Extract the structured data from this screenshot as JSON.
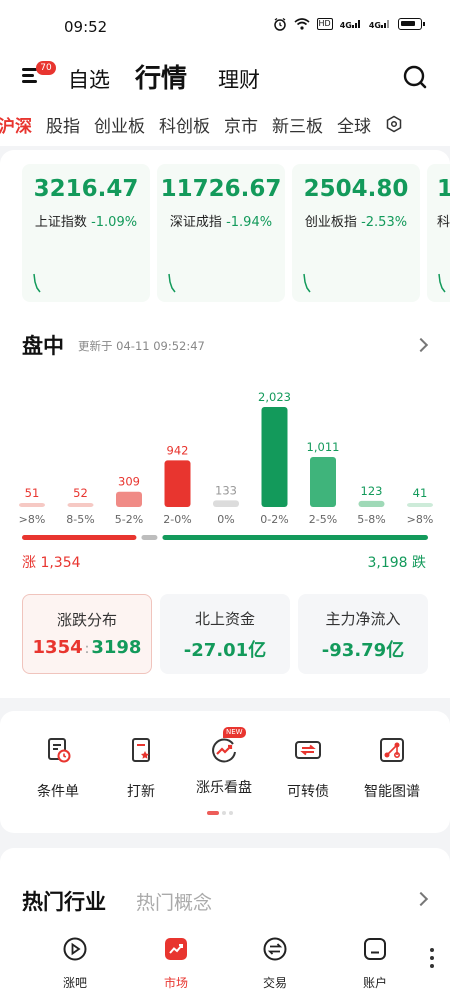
{
  "status_bar": {
    "time": "09:52",
    "hd": "HD",
    "net1": "4G",
    "net2": "4G"
  },
  "header": {
    "badge": "70",
    "tabs": [
      "自选",
      "行情",
      "理财"
    ],
    "active_tab": 1
  },
  "market_tabs": {
    "items": [
      "沪深",
      "股指",
      "创业板",
      "科创板",
      "京市",
      "新三板",
      "全球"
    ],
    "active": 0
  },
  "indices": [
    {
      "value": "3216.47",
      "name": "上证指数",
      "change": "-1.09%"
    },
    {
      "value": "11726.67",
      "name": "深证成指",
      "change": "-1.94%"
    },
    {
      "value": "2504.80",
      "name": "创业板指",
      "change": "-2.53%"
    },
    {
      "value": "1",
      "name": "科",
      "change": ""
    }
  ],
  "intraday": {
    "title": "盘中",
    "update": "更新于 04-11 09:52:47"
  },
  "chart_data": {
    "type": "bar",
    "categories": [
      ">8%",
      "8-5%",
      "5-2%",
      "2-0%",
      "0%",
      "0-2%",
      "2-5%",
      "5-8%",
      ">8%"
    ],
    "values": [
      51,
      52,
      309,
      942,
      133,
      2023,
      1011,
      123,
      41
    ],
    "value_labels": [
      "51",
      "52",
      "309",
      "942",
      "133",
      "2,023",
      "1,011",
      "123",
      "41"
    ],
    "colors": [
      "#f6c9c4",
      "#f6c9c4",
      "#f08b86",
      "#e8352f",
      "#dcdcdc",
      "#139a5b",
      "#3fb47b",
      "#9fd9b7",
      "#cdebd9"
    ],
    "label_colors": [
      "#e8352f",
      "#e8352f",
      "#e8352f",
      "#e8352f",
      "#999999",
      "#139a5b",
      "#139a5b",
      "#139a5b",
      "#139a5b"
    ]
  },
  "breadth": {
    "up_label": "涨 1,354",
    "down_label": "3,198 跌",
    "up": 1354,
    "flat": 133,
    "down": 3198
  },
  "summary_cards": [
    {
      "title": "涨跌分布",
      "up": "1354",
      "sep": ":",
      "down": "3198"
    },
    {
      "title": "北上资金",
      "value": "-27.01亿"
    },
    {
      "title": "主力净流入",
      "value": "-93.79亿"
    }
  ],
  "tools": [
    {
      "label": "条件单",
      "icon": "condition-order-icon"
    },
    {
      "label": "打新",
      "icon": "ipo-icon"
    },
    {
      "label": "涨乐看盘",
      "icon": "market-watch-icon",
      "badge": "NEW"
    },
    {
      "label": "可转债",
      "icon": "convertible-bond-icon"
    },
    {
      "label": "智能图谱",
      "icon": "smart-graph-icon"
    }
  ],
  "hot": {
    "title": "热门行业",
    "alt": "热门概念"
  },
  "bottom_nav": [
    {
      "label": "涨吧",
      "icon": "play-circle-icon"
    },
    {
      "label": "市场",
      "icon": "market-chart-icon"
    },
    {
      "label": "交易",
      "icon": "trade-icon"
    },
    {
      "label": "账户",
      "icon": "account-icon"
    }
  ],
  "bottom_nav_active": 1,
  "colors": {
    "up": "#e8352f",
    "down": "#139a5b",
    "flat": "#bdbdbd"
  }
}
